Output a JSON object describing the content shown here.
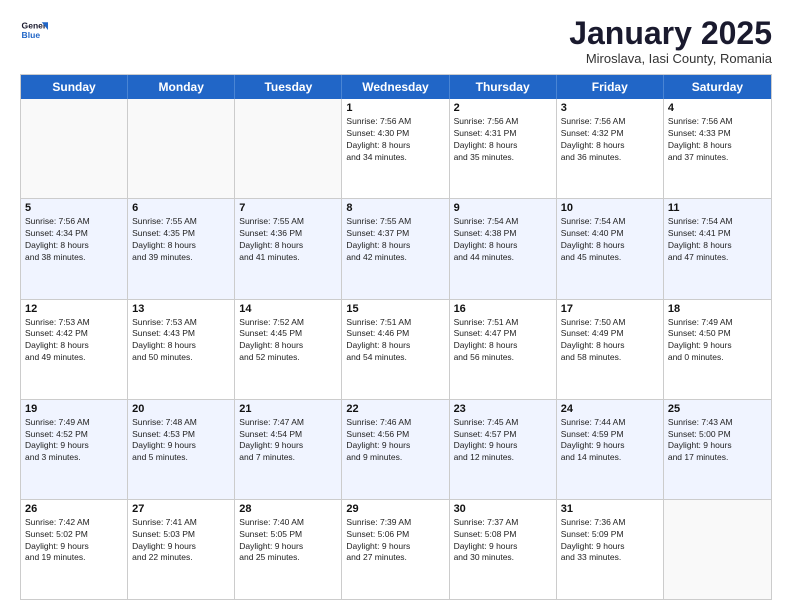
{
  "logo": {
    "general": "General",
    "blue": "Blue"
  },
  "title": "January 2025",
  "subtitle": "Miroslava, Iasi County, Romania",
  "days": [
    "Sunday",
    "Monday",
    "Tuesday",
    "Wednesday",
    "Thursday",
    "Friday",
    "Saturday"
  ],
  "rows": [
    {
      "alt": false,
      "cells": [
        {
          "day": "",
          "content": ""
        },
        {
          "day": "",
          "content": ""
        },
        {
          "day": "",
          "content": ""
        },
        {
          "day": "1",
          "content": "Sunrise: 7:56 AM\nSunset: 4:30 PM\nDaylight: 8 hours\nand 34 minutes."
        },
        {
          "day": "2",
          "content": "Sunrise: 7:56 AM\nSunset: 4:31 PM\nDaylight: 8 hours\nand 35 minutes."
        },
        {
          "day": "3",
          "content": "Sunrise: 7:56 AM\nSunset: 4:32 PM\nDaylight: 8 hours\nand 36 minutes."
        },
        {
          "day": "4",
          "content": "Sunrise: 7:56 AM\nSunset: 4:33 PM\nDaylight: 8 hours\nand 37 minutes."
        }
      ]
    },
    {
      "alt": true,
      "cells": [
        {
          "day": "5",
          "content": "Sunrise: 7:56 AM\nSunset: 4:34 PM\nDaylight: 8 hours\nand 38 minutes."
        },
        {
          "day": "6",
          "content": "Sunrise: 7:55 AM\nSunset: 4:35 PM\nDaylight: 8 hours\nand 39 minutes."
        },
        {
          "day": "7",
          "content": "Sunrise: 7:55 AM\nSunset: 4:36 PM\nDaylight: 8 hours\nand 41 minutes."
        },
        {
          "day": "8",
          "content": "Sunrise: 7:55 AM\nSunset: 4:37 PM\nDaylight: 8 hours\nand 42 minutes."
        },
        {
          "day": "9",
          "content": "Sunrise: 7:54 AM\nSunset: 4:38 PM\nDaylight: 8 hours\nand 44 minutes."
        },
        {
          "day": "10",
          "content": "Sunrise: 7:54 AM\nSunset: 4:40 PM\nDaylight: 8 hours\nand 45 minutes."
        },
        {
          "day": "11",
          "content": "Sunrise: 7:54 AM\nSunset: 4:41 PM\nDaylight: 8 hours\nand 47 minutes."
        }
      ]
    },
    {
      "alt": false,
      "cells": [
        {
          "day": "12",
          "content": "Sunrise: 7:53 AM\nSunset: 4:42 PM\nDaylight: 8 hours\nand 49 minutes."
        },
        {
          "day": "13",
          "content": "Sunrise: 7:53 AM\nSunset: 4:43 PM\nDaylight: 8 hours\nand 50 minutes."
        },
        {
          "day": "14",
          "content": "Sunrise: 7:52 AM\nSunset: 4:45 PM\nDaylight: 8 hours\nand 52 minutes."
        },
        {
          "day": "15",
          "content": "Sunrise: 7:51 AM\nSunset: 4:46 PM\nDaylight: 8 hours\nand 54 minutes."
        },
        {
          "day": "16",
          "content": "Sunrise: 7:51 AM\nSunset: 4:47 PM\nDaylight: 8 hours\nand 56 minutes."
        },
        {
          "day": "17",
          "content": "Sunrise: 7:50 AM\nSunset: 4:49 PM\nDaylight: 8 hours\nand 58 minutes."
        },
        {
          "day": "18",
          "content": "Sunrise: 7:49 AM\nSunset: 4:50 PM\nDaylight: 9 hours\nand 0 minutes."
        }
      ]
    },
    {
      "alt": true,
      "cells": [
        {
          "day": "19",
          "content": "Sunrise: 7:49 AM\nSunset: 4:52 PM\nDaylight: 9 hours\nand 3 minutes."
        },
        {
          "day": "20",
          "content": "Sunrise: 7:48 AM\nSunset: 4:53 PM\nDaylight: 9 hours\nand 5 minutes."
        },
        {
          "day": "21",
          "content": "Sunrise: 7:47 AM\nSunset: 4:54 PM\nDaylight: 9 hours\nand 7 minutes."
        },
        {
          "day": "22",
          "content": "Sunrise: 7:46 AM\nSunset: 4:56 PM\nDaylight: 9 hours\nand 9 minutes."
        },
        {
          "day": "23",
          "content": "Sunrise: 7:45 AM\nSunset: 4:57 PM\nDaylight: 9 hours\nand 12 minutes."
        },
        {
          "day": "24",
          "content": "Sunrise: 7:44 AM\nSunset: 4:59 PM\nDaylight: 9 hours\nand 14 minutes."
        },
        {
          "day": "25",
          "content": "Sunrise: 7:43 AM\nSunset: 5:00 PM\nDaylight: 9 hours\nand 17 minutes."
        }
      ]
    },
    {
      "alt": false,
      "cells": [
        {
          "day": "26",
          "content": "Sunrise: 7:42 AM\nSunset: 5:02 PM\nDaylight: 9 hours\nand 19 minutes."
        },
        {
          "day": "27",
          "content": "Sunrise: 7:41 AM\nSunset: 5:03 PM\nDaylight: 9 hours\nand 22 minutes."
        },
        {
          "day": "28",
          "content": "Sunrise: 7:40 AM\nSunset: 5:05 PM\nDaylight: 9 hours\nand 25 minutes."
        },
        {
          "day": "29",
          "content": "Sunrise: 7:39 AM\nSunset: 5:06 PM\nDaylight: 9 hours\nand 27 minutes."
        },
        {
          "day": "30",
          "content": "Sunrise: 7:37 AM\nSunset: 5:08 PM\nDaylight: 9 hours\nand 30 minutes."
        },
        {
          "day": "31",
          "content": "Sunrise: 7:36 AM\nSunset: 5:09 PM\nDaylight: 9 hours\nand 33 minutes."
        },
        {
          "day": "",
          "content": ""
        }
      ]
    }
  ]
}
